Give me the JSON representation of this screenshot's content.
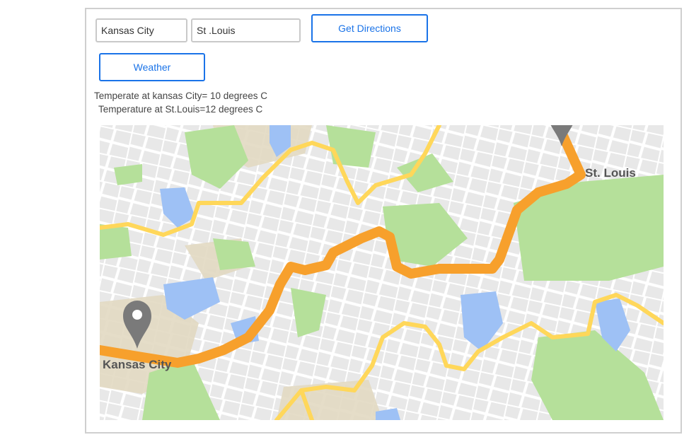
{
  "form": {
    "origin_value": "Kansas City",
    "destination_value": "St .Louis",
    "directions_button": "Get Directions",
    "weather_button": "Weather"
  },
  "weather": {
    "line1": "Temperate at kansas City= 10 degrees C",
    "line2": "Temperature at St.Louis=12 degrees C"
  },
  "map": {
    "origin_label": "Kansas City",
    "destination_label": "St. Louis",
    "route_color": "#f7a02c",
    "road_color": "#ffd75a",
    "pin_color": "#7a7a7a",
    "park_color": "#b5e09a",
    "water_color": "#9ec1f5"
  },
  "icons": {
    "origin_pin": "map-pin-icon",
    "destination_pin": "map-pin-icon"
  }
}
